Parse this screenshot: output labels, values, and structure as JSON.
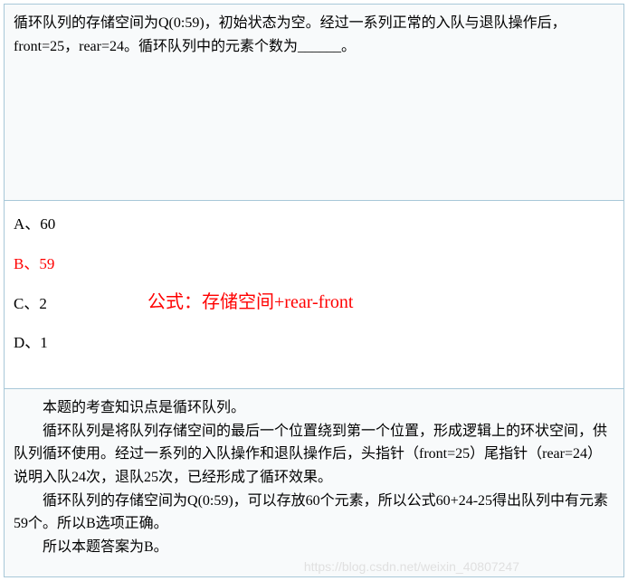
{
  "question": {
    "text": "循环队列的存储空间为Q(0:59)，初始状态为空。经过一系列正常的入队与退队操作后，front=25，rear=24。循环队列中的元素个数为______。"
  },
  "options": [
    {
      "label": "A、60",
      "correct": false
    },
    {
      "label": "B、59",
      "correct": true
    },
    {
      "label": "C、2",
      "correct": false
    },
    {
      "label": "D、1",
      "correct": false
    }
  ],
  "formula": "公式：存储空间+rear-front",
  "explanation": {
    "p1": "本题的考查知识点是循环队列。",
    "p2": "循环队列是将队列存储空间的最后一个位置绕到第一个位置，形成逻辑上的环状空间，供队列循环使用。经过一系列的入队操作和退队操作后，头指针（front=25）尾指针（rear=24）说明入队24次，退队25次，已经形成了循环效果。",
    "p3": "循环队列的存储空间为Q(0:59)，可以存放60个元素，所以公式60+24-25得出队列中有元素59个。所以B选项正确。",
    "p4": "所以本题答案为B。"
  },
  "watermark": "https://blog.csdn.net/weixin_40807247"
}
